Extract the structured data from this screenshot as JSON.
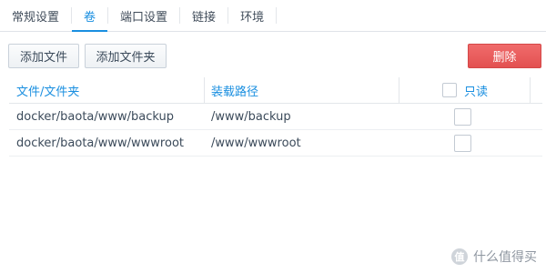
{
  "tabs": [
    {
      "label": "常规设置",
      "active": false
    },
    {
      "label": "卷",
      "active": true
    },
    {
      "label": "端口设置",
      "active": false
    },
    {
      "label": "链接",
      "active": false
    },
    {
      "label": "环境",
      "active": false
    }
  ],
  "toolbar": {
    "add_file": "添加文件",
    "add_folder": "添加文件夹",
    "delete": "删除"
  },
  "table": {
    "headers": {
      "file_folder": "文件/文件夹",
      "mount_path": "装载路径",
      "readonly": "只读"
    },
    "rows": [
      {
        "file": "docker/baota/www/backup",
        "mount": "/www/backup",
        "readonly": false
      },
      {
        "file": "docker/baota/www/wwwroot",
        "mount": "/www/wwwroot",
        "readonly": false
      }
    ]
  },
  "watermark": {
    "logo": "值",
    "text": "什么值得买"
  },
  "colors": {
    "accent": "#1a8fe0",
    "danger": "#e35151",
    "border": "#dfe3e8"
  }
}
